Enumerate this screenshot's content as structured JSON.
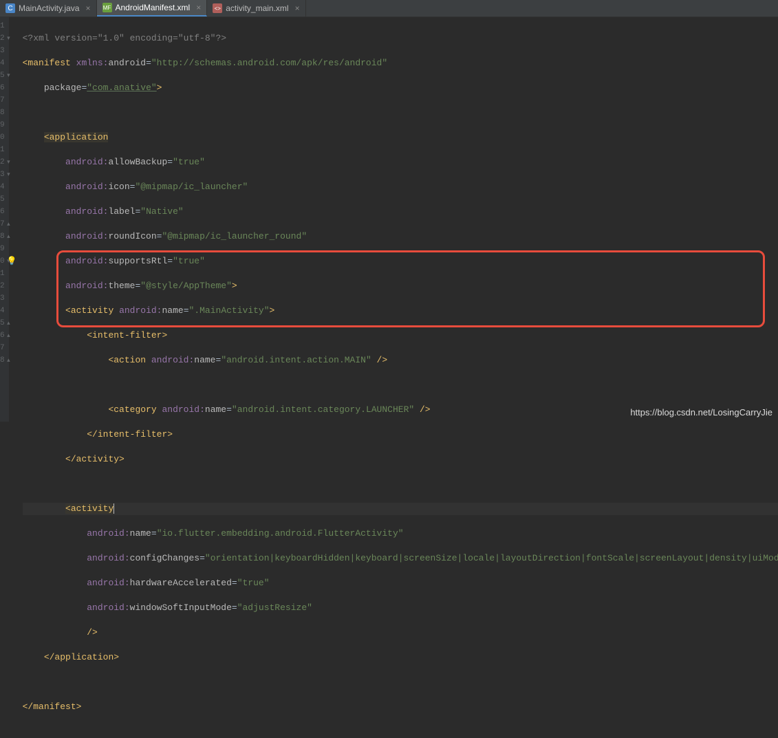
{
  "tabs": [
    {
      "label": "MainActivity.java",
      "iconColor": "#4a86c7",
      "iconText": "C"
    },
    {
      "label": "AndroidManifest.xml",
      "iconColor": "#6a9f3f",
      "iconText": "MF"
    },
    {
      "label": "activity_main.xml",
      "iconColor": "#b05f5b",
      "iconText": "<>"
    }
  ],
  "watermark": "https://blog.csdn.net/LosingCarryJie",
  "gutter": [
    "1",
    "2",
    "3",
    "4",
    "5",
    "6",
    "7",
    "8",
    "9",
    "0",
    "1",
    "2",
    "3",
    "4",
    "5",
    "6",
    "7",
    "8",
    "9",
    "0",
    "1",
    "2",
    "3",
    "4",
    "5",
    "6",
    "7",
    "8"
  ],
  "code": {
    "l1_decl": "<?xml version=\"1.0\" encoding=\"utf-8\"?>",
    "l2_tag": "<manifest",
    "l2_ns": "xmlns:",
    "l2_attr": "android",
    "l2_val": "\"http://schemas.android.com/apk/res/android\"",
    "l3_attr": "package",
    "l3_val": "\"com.anative\"",
    "l3_close": ">",
    "l5_tag": "<application",
    "l6_ns": "android:",
    "l6_attr": "allowBackup",
    "l6_val": "\"true\"",
    "l7_ns": "android:",
    "l7_attr": "icon",
    "l7_val": "\"@mipmap/ic_launcher\"",
    "l8_ns": "android:",
    "l8_attr": "label",
    "l8_val": "\"Native\"",
    "l9_ns": "android:",
    "l9_attr": "roundIcon",
    "l9_val": "\"@mipmap/ic_launcher_round\"",
    "l10_ns": "android:",
    "l10_attr": "supportsRtl",
    "l10_val": "\"true\"",
    "l11_ns": "android:",
    "l11_attr": "theme",
    "l11_val": "\"@style/AppTheme\"",
    "l11_close": ">",
    "l12_tag": "<activity",
    "l12_ns": "android:",
    "l12_attr": "name",
    "l12_val": "\".MainActivity\"",
    "l12_close": ">",
    "l13_tag": "<intent-filter>",
    "l14_tag": "<action",
    "l14_ns": "android:",
    "l14_attr": "name",
    "l14_val": "\"android.intent.action.MAIN\"",
    "l14_close": " />",
    "l16_tag": "<category",
    "l16_ns": "android:",
    "l16_attr": "name",
    "l16_val": "\"android.intent.category.LAUNCHER\"",
    "l16_close": " />",
    "l17_tag": "</intent-filter>",
    "l18_tag": "</activity>",
    "l20_tag": "<activity",
    "l21_ns": "android:",
    "l21_attr": "name",
    "l21_val": "\"io.flutter.embedding.android.FlutterActivity\"",
    "l22_ns": "android:",
    "l22_attr": "configChanges",
    "l22_val": "\"orientation|keyboardHidden|keyboard|screenSize|locale|layoutDirection|fontScale|screenLayout|density|uiMode\"",
    "l23_ns": "android:",
    "l23_attr": "hardwareAccelerated",
    "l23_val": "\"true\"",
    "l24_ns": "android:",
    "l24_attr": "windowSoftInputMode",
    "l24_val": "\"adjustResize\"",
    "l25_close": "/>",
    "l26_tag": "</application>",
    "l28_tag": "</manifest>"
  }
}
